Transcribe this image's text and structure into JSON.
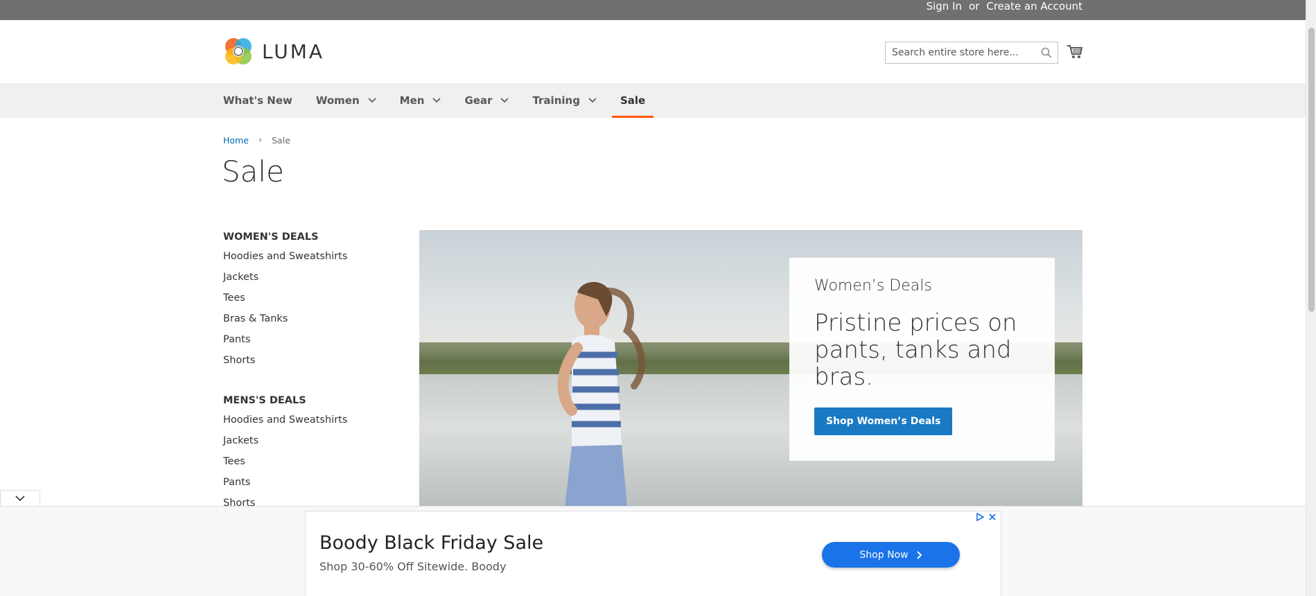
{
  "topbar": {
    "sign_in": "Sign In",
    "or": "or",
    "create_account": "Create an Account"
  },
  "header": {
    "logo_text": "LUMA",
    "search_placeholder": "Search entire store here..."
  },
  "nav": {
    "items": [
      {
        "label": "What's New",
        "has_dropdown": false
      },
      {
        "label": "Women",
        "has_dropdown": true
      },
      {
        "label": "Men",
        "has_dropdown": true
      },
      {
        "label": "Gear",
        "has_dropdown": true
      },
      {
        "label": "Training",
        "has_dropdown": true
      },
      {
        "label": "Sale",
        "has_dropdown": false,
        "active": true
      }
    ],
    "accent": "#ff5501"
  },
  "breadcrumb": {
    "home": "Home",
    "separator": "›",
    "current": "Sale"
  },
  "page": {
    "title": "Sale"
  },
  "sidebar": {
    "sections": [
      {
        "heading": "WOMEN'S DEALS",
        "links": [
          "Hoodies and Sweatshirts",
          "Jackets",
          "Tees",
          "Bras & Tanks",
          "Pants",
          "Shorts"
        ]
      },
      {
        "heading": "MENS'S DEALS",
        "links": [
          "Hoodies and Sweatshirts",
          "Jackets",
          "Tees",
          "Pants",
          "Shorts"
        ]
      }
    ]
  },
  "hero": {
    "eyebrow": "Women’s Deals",
    "headline": "Pristine prices on pants, tanks and bras.",
    "button": "Shop Women’s Deals",
    "button_color": "#1979c3"
  },
  "ad": {
    "title": "Boody Black Friday Sale",
    "subtitle": "Shop 30-60% Off Sitewide. Boody",
    "button": "Shop Now",
    "button_color": "#1a73e8"
  }
}
